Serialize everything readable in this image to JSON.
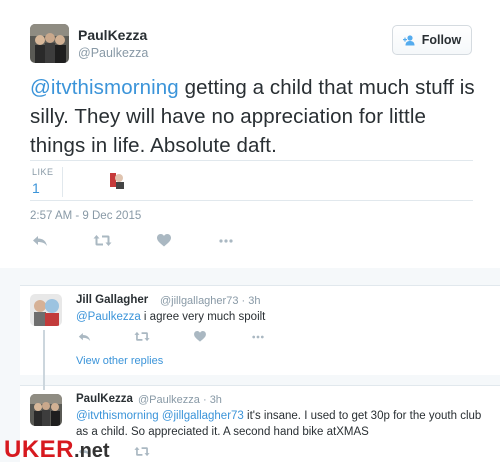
{
  "tweet": {
    "author_name": "PaulKezza",
    "author_handle": "@Paulkezza",
    "follow_label": "Follow",
    "text_mention": "@itvthismorning",
    "text_body": " getting a child that much stuff is silly. They will have no appreciation for little things in life.  Absolute daft.",
    "likes_label": "LIKE",
    "likes_count": "1",
    "timestamp": "2:57 AM - 9 Dec 2015"
  },
  "replies": [
    {
      "name": "Jill Gallagher",
      "meta": "@jillgallagher73 · 3h",
      "mention": "@Paulkezza",
      "text": " i agree very much spoilt"
    },
    {
      "name": "PaulKezza",
      "meta": "@Paulkezza · 3h",
      "mention1": "@itvthismorning",
      "mention2": "@jillgallagher73",
      "text": " it's insane.  I used to get 30p for the youth club as a child. So appreciated it. A second hand bike atXMAS"
    }
  ],
  "view_other_replies": "View other replies",
  "watermark": {
    "brand": "UKER",
    "dot": ".",
    "suffix": "net"
  },
  "icons": {
    "reply": "reply-icon",
    "retweet": "retweet-icon",
    "like": "heart-icon",
    "more": "more-dots-icon",
    "follow": "follow-user-icon"
  },
  "colors": {
    "link": "#3b94d9",
    "muted": "#8899a6",
    "icon": "#aab8c2",
    "watermark_red": "#d7191f"
  }
}
